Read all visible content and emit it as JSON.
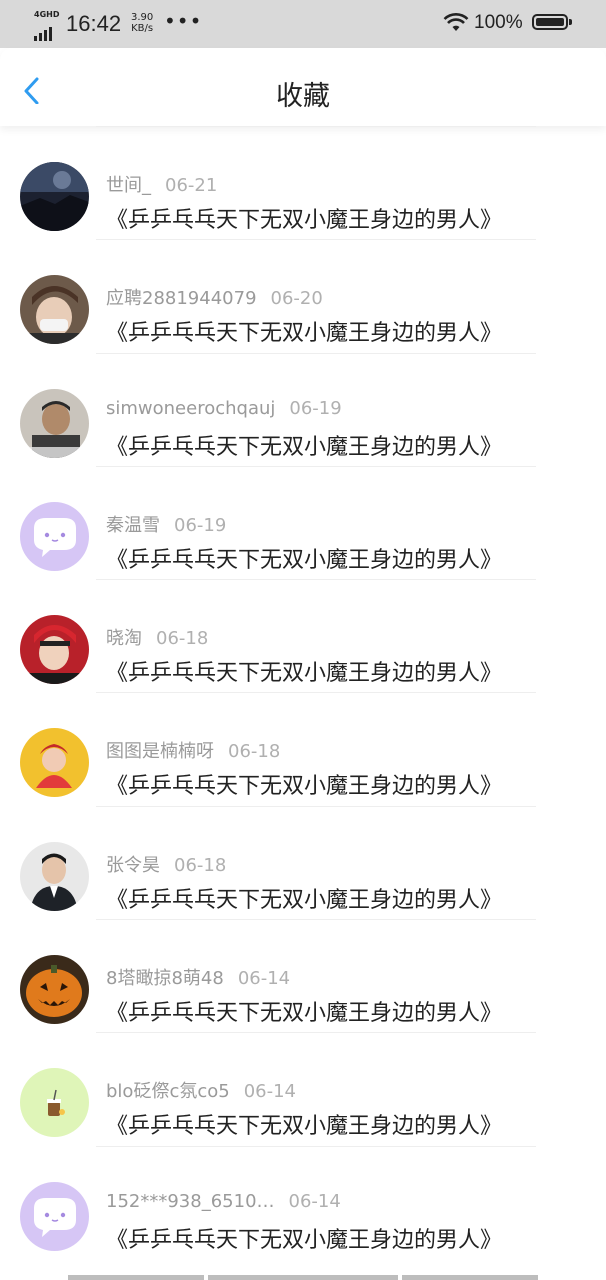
{
  "status_bar": {
    "network": "4GHD",
    "time": "16:42",
    "speed_value": "3.90",
    "speed_unit": "KB/s",
    "more": "•••",
    "battery": "100%"
  },
  "header": {
    "title": "收藏",
    "back_icon": "chevron-left-icon",
    "accent": "#2f9cf0"
  },
  "favorites": [
    {
      "user": "世间_",
      "date": "06-21",
      "title": "《乒乒乓乓天下无双小魔王身边的男人》",
      "avatar": "night-landscape"
    },
    {
      "user": "应聘2881944079",
      "date": "06-20",
      "title": "《乒乒乓乓天下无双小魔王身边的男人》",
      "avatar": "girl-with-cap"
    },
    {
      "user": "simwoneerochqauj",
      "date": "06-19",
      "title": "《乒乒乓乓天下无双小魔王身边的男人》",
      "avatar": "boy-photo"
    },
    {
      "user": "秦温雪",
      "date": "06-19",
      "title": "《乒乒乓乓天下无双小魔王身边的男人》",
      "avatar": "purple-chat-default"
    },
    {
      "user": "晓淘",
      "date": "06-18",
      "title": "《乒乒乓乓天下无双小魔王身边的男人》",
      "avatar": "red-helmet"
    },
    {
      "user": "图图是楠楠呀",
      "date": "06-18",
      "title": "《乒乒乓乓天下无双小魔王身边的男人》",
      "avatar": "girl-yellow-bg"
    },
    {
      "user": "张令昊",
      "date": "06-18",
      "title": "《乒乒乓乓天下无双小魔王身边的男人》",
      "avatar": "man-in-suit"
    },
    {
      "user": "8塔瞰掠8萌48",
      "date": "06-14",
      "title": "《乒乒乓乓天下无双小魔王身边的男人》",
      "avatar": "pumpkin"
    },
    {
      "user": "blo砭傺c氛co5",
      "date": "06-14",
      "title": "《乒乒乓乓天下无双小魔王身边的男人》",
      "avatar": "green-drink"
    },
    {
      "user": "152***938_6510…",
      "date": "06-14",
      "title": "《乒乒乓乓天下无双小魔王身边的男人》",
      "avatar": "purple-chat-default"
    }
  ]
}
